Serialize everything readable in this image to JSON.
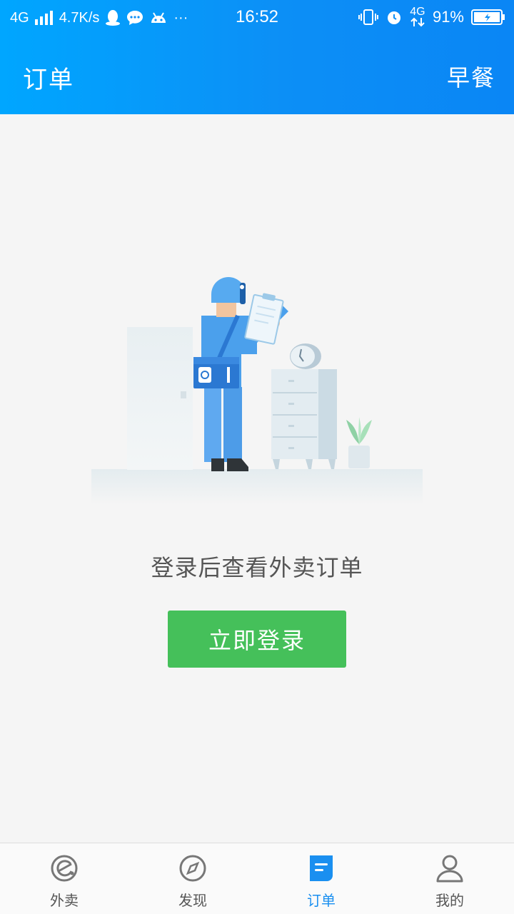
{
  "status_bar": {
    "network": "4G",
    "speed": "4.7K/s",
    "more": "···",
    "time": "16:52",
    "network_right": "4G",
    "battery": "91%"
  },
  "header": {
    "title": "订单",
    "action": "早餐"
  },
  "empty_state": {
    "message": "登录后查看外卖订单",
    "button_label": "立即登录"
  },
  "tabs": [
    {
      "label": "外卖",
      "icon": "eleme-logo-icon",
      "active": false
    },
    {
      "label": "发现",
      "icon": "compass-icon",
      "active": false
    },
    {
      "label": "订单",
      "icon": "order-document-icon",
      "active": true
    },
    {
      "label": "我的",
      "icon": "user-icon",
      "active": false
    }
  ],
  "colors": {
    "header_gradient_start": "#00a6ff",
    "header_gradient_end": "#0a86f5",
    "button_green": "#45c05a",
    "tab_active": "#1a8ff0",
    "tab_inactive": "#777777"
  }
}
